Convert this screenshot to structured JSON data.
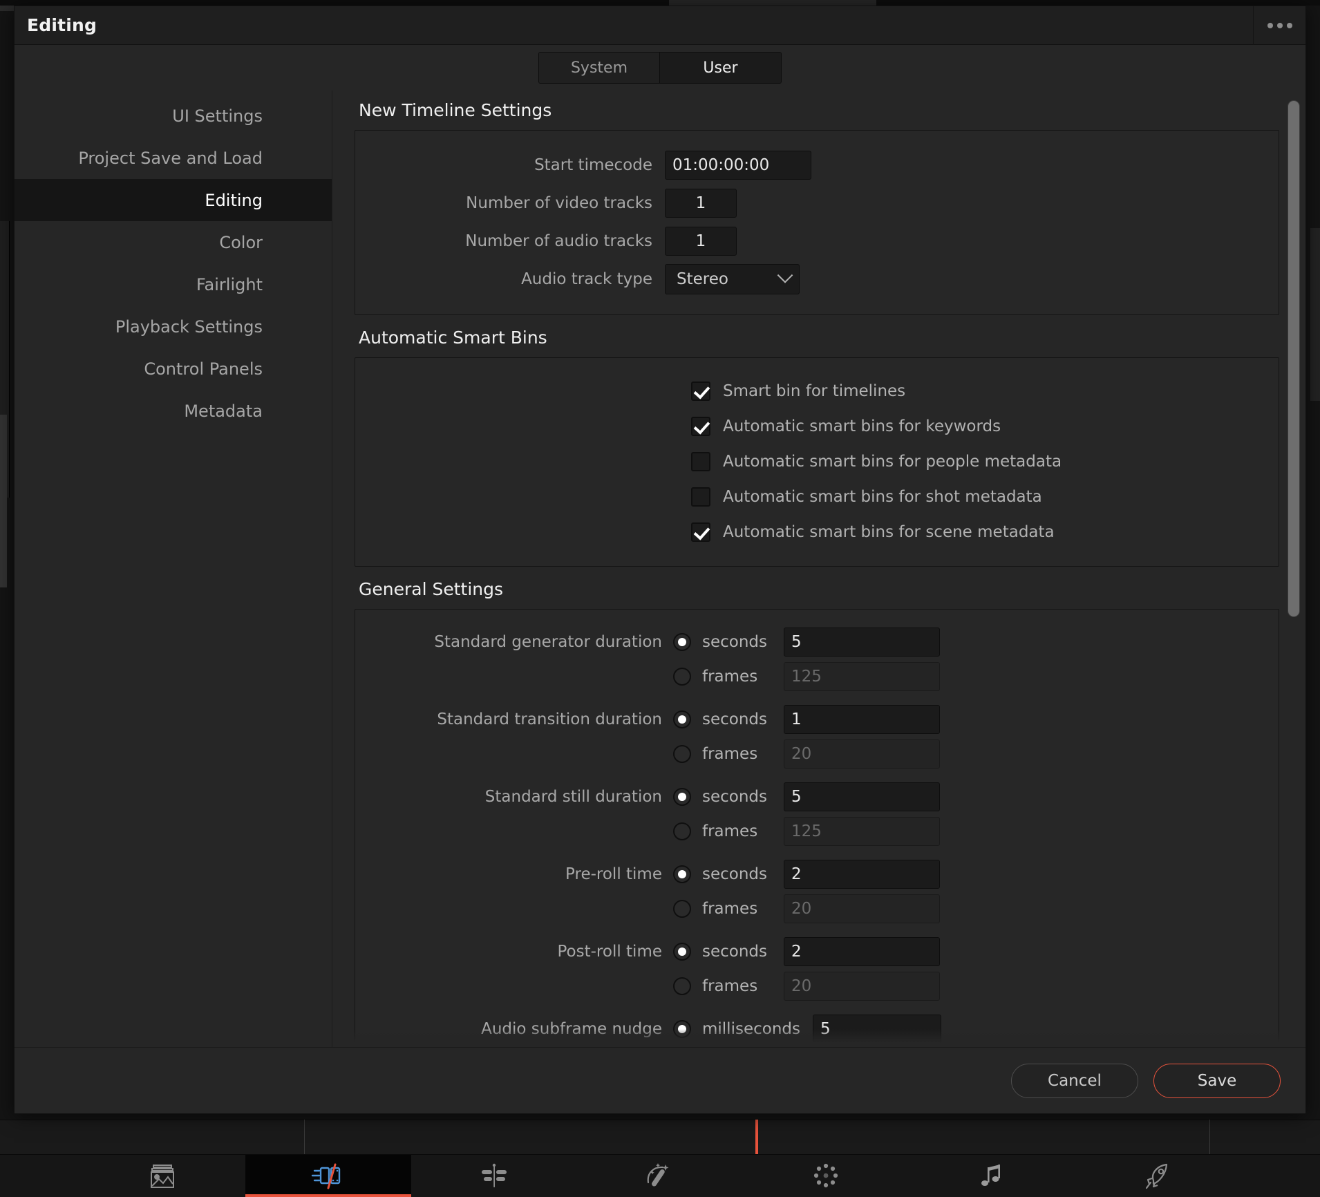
{
  "window": {
    "title": "Editing",
    "menu_icon": "ellipsis-icon"
  },
  "tabs": [
    {
      "label": "System",
      "active": false
    },
    {
      "label": "User",
      "active": true
    }
  ],
  "sidebar": {
    "items": [
      {
        "label": "UI Settings",
        "active": false
      },
      {
        "label": "Project Save and Load",
        "active": false
      },
      {
        "label": "Editing",
        "active": true
      },
      {
        "label": "Color",
        "active": false
      },
      {
        "label": "Fairlight",
        "active": false
      },
      {
        "label": "Playback Settings",
        "active": false
      },
      {
        "label": "Control Panels",
        "active": false
      },
      {
        "label": "Metadata",
        "active": false
      }
    ]
  },
  "new_timeline_settings": {
    "title": "New Timeline Settings",
    "start_timecode": {
      "label": "Start timecode",
      "value": "01:00:00:00"
    },
    "video_tracks": {
      "label": "Number of video tracks",
      "value": "1"
    },
    "audio_tracks": {
      "label": "Number of audio tracks",
      "value": "1"
    },
    "audio_track_type": {
      "label": "Audio track type",
      "value": "Stereo",
      "chevron": "chevron-down-icon"
    }
  },
  "automatic_smart_bins": {
    "title": "Automatic Smart Bins",
    "options": [
      {
        "label": "Smart bin for timelines",
        "checked": true
      },
      {
        "label": "Automatic smart bins for keywords",
        "checked": true
      },
      {
        "label": "Automatic smart bins for people metadata",
        "checked": false
      },
      {
        "label": "Automatic smart bins for shot metadata",
        "checked": false
      },
      {
        "label": "Automatic smart bins for scene metadata",
        "checked": true
      }
    ]
  },
  "general_settings": {
    "title": "General Settings",
    "rows": [
      {
        "label": "Standard generator duration",
        "units": [
          {
            "unit": "seconds",
            "selected": true,
            "value": "5",
            "enabled": true
          },
          {
            "unit": "frames",
            "selected": false,
            "value": "125",
            "enabled": false
          }
        ]
      },
      {
        "label": "Standard transition duration",
        "units": [
          {
            "unit": "seconds",
            "selected": true,
            "value": "1",
            "enabled": true
          },
          {
            "unit": "frames",
            "selected": false,
            "value": "20",
            "enabled": false
          }
        ]
      },
      {
        "label": "Standard still duration",
        "units": [
          {
            "unit": "seconds",
            "selected": true,
            "value": "5",
            "enabled": true
          },
          {
            "unit": "frames",
            "selected": false,
            "value": "125",
            "enabled": false
          }
        ]
      },
      {
        "label": "Pre-roll time",
        "units": [
          {
            "unit": "seconds",
            "selected": true,
            "value": "2",
            "enabled": true
          },
          {
            "unit": "frames",
            "selected": false,
            "value": "20",
            "enabled": false
          }
        ]
      },
      {
        "label": "Post-roll time",
        "units": [
          {
            "unit": "seconds",
            "selected": true,
            "value": "2",
            "enabled": true
          },
          {
            "unit": "frames",
            "selected": false,
            "value": "20",
            "enabled": false
          }
        ]
      },
      {
        "label": "Audio subframe nudge",
        "units": [
          {
            "unit": "milliseconds",
            "selected": true,
            "value": "5",
            "enabled": true
          }
        ]
      }
    ]
  },
  "footer": {
    "cancel_label": "Cancel",
    "save_label": "Save"
  },
  "page_toolbar": {
    "pages": [
      {
        "name": "media-page",
        "icon": "media-icon",
        "active": false
      },
      {
        "name": "edit-page",
        "icon": "edit-icon",
        "active": true
      },
      {
        "name": "cut-page",
        "icon": "cut-icon",
        "active": false
      },
      {
        "name": "fusion-page",
        "icon": "fusion-icon",
        "active": false
      },
      {
        "name": "color-page",
        "icon": "color-icon",
        "active": false
      },
      {
        "name": "fairlight-page",
        "icon": "fairlight-icon",
        "active": false
      },
      {
        "name": "deliver-page",
        "icon": "deliver-icon",
        "active": false
      }
    ]
  },
  "colors": {
    "accent": "#e8533c",
    "dialog_bg": "#262626",
    "titlebar_bg": "#1f1f1f",
    "field_bg": "#1b1b1b",
    "text": "#b2b2b2"
  }
}
